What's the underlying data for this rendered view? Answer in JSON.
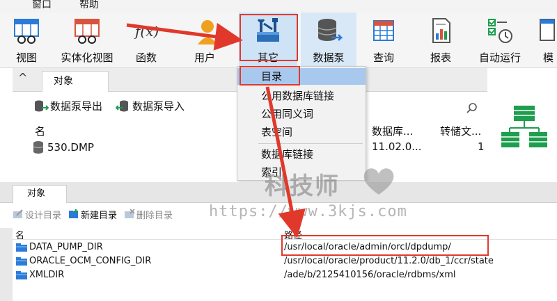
{
  "menubar": {
    "items": [
      "窗口",
      "帮助"
    ]
  },
  "toolbar": {
    "buttons": [
      {
        "id": "view",
        "label": "视图"
      },
      {
        "id": "mview",
        "label": "实体化视图"
      },
      {
        "id": "function",
        "label": "函数"
      },
      {
        "id": "user",
        "label": "用户"
      },
      {
        "id": "other",
        "label": "其它"
      },
      {
        "id": "datapump",
        "label": "数据泵"
      },
      {
        "id": "query",
        "label": "查询"
      },
      {
        "id": "report",
        "label": "报表"
      },
      {
        "id": "autorun",
        "label": "自动运行"
      },
      {
        "id": "model",
        "label": "模"
      }
    ],
    "fx_text": "f(x)"
  },
  "top_pane": {
    "tab_label": "对象",
    "collapse_glyph": "^",
    "export_label": "数据泵导出",
    "import_label": "数据泵导入",
    "columns": {
      "name": "名",
      "db": "数据库...",
      "dump": "转储文..."
    },
    "rows": [
      {
        "name": "530.DMP",
        "db": "11.02.0...",
        "dump": "1"
      }
    ]
  },
  "dropdown": {
    "items": [
      "目录",
      "公用数据库链接",
      "公用同义词",
      "表空间",
      "数据库链接",
      "索引"
    ]
  },
  "bottom_pane": {
    "tab_label": "对象",
    "design_label": "设计目录",
    "new_label": "新建目录",
    "delete_label": "删除目录",
    "columns": {
      "name": "名",
      "path": "路径"
    },
    "rows": [
      {
        "name": "DATA_PUMP_DIR",
        "path": "/usr/local/oracle/admin/orcl/dpdump/"
      },
      {
        "name": "ORACLE_OCM_CONFIG_DIR",
        "path": "/usr/local/oracle/product/11.2.0/db_1/ccr/state"
      },
      {
        "name": "XMLDIR",
        "path": "/ade/b/2125410156/oracle/rdbms/xml"
      }
    ]
  },
  "watermark": {
    "text": "科技师",
    "url": "https://www.3kjs.com"
  },
  "colors": {
    "accent_red": "#e0392b",
    "selection_blue": "#a8c8ee",
    "icon_blue": "#2b7bd8",
    "icon_green": "#1e9e4e"
  }
}
